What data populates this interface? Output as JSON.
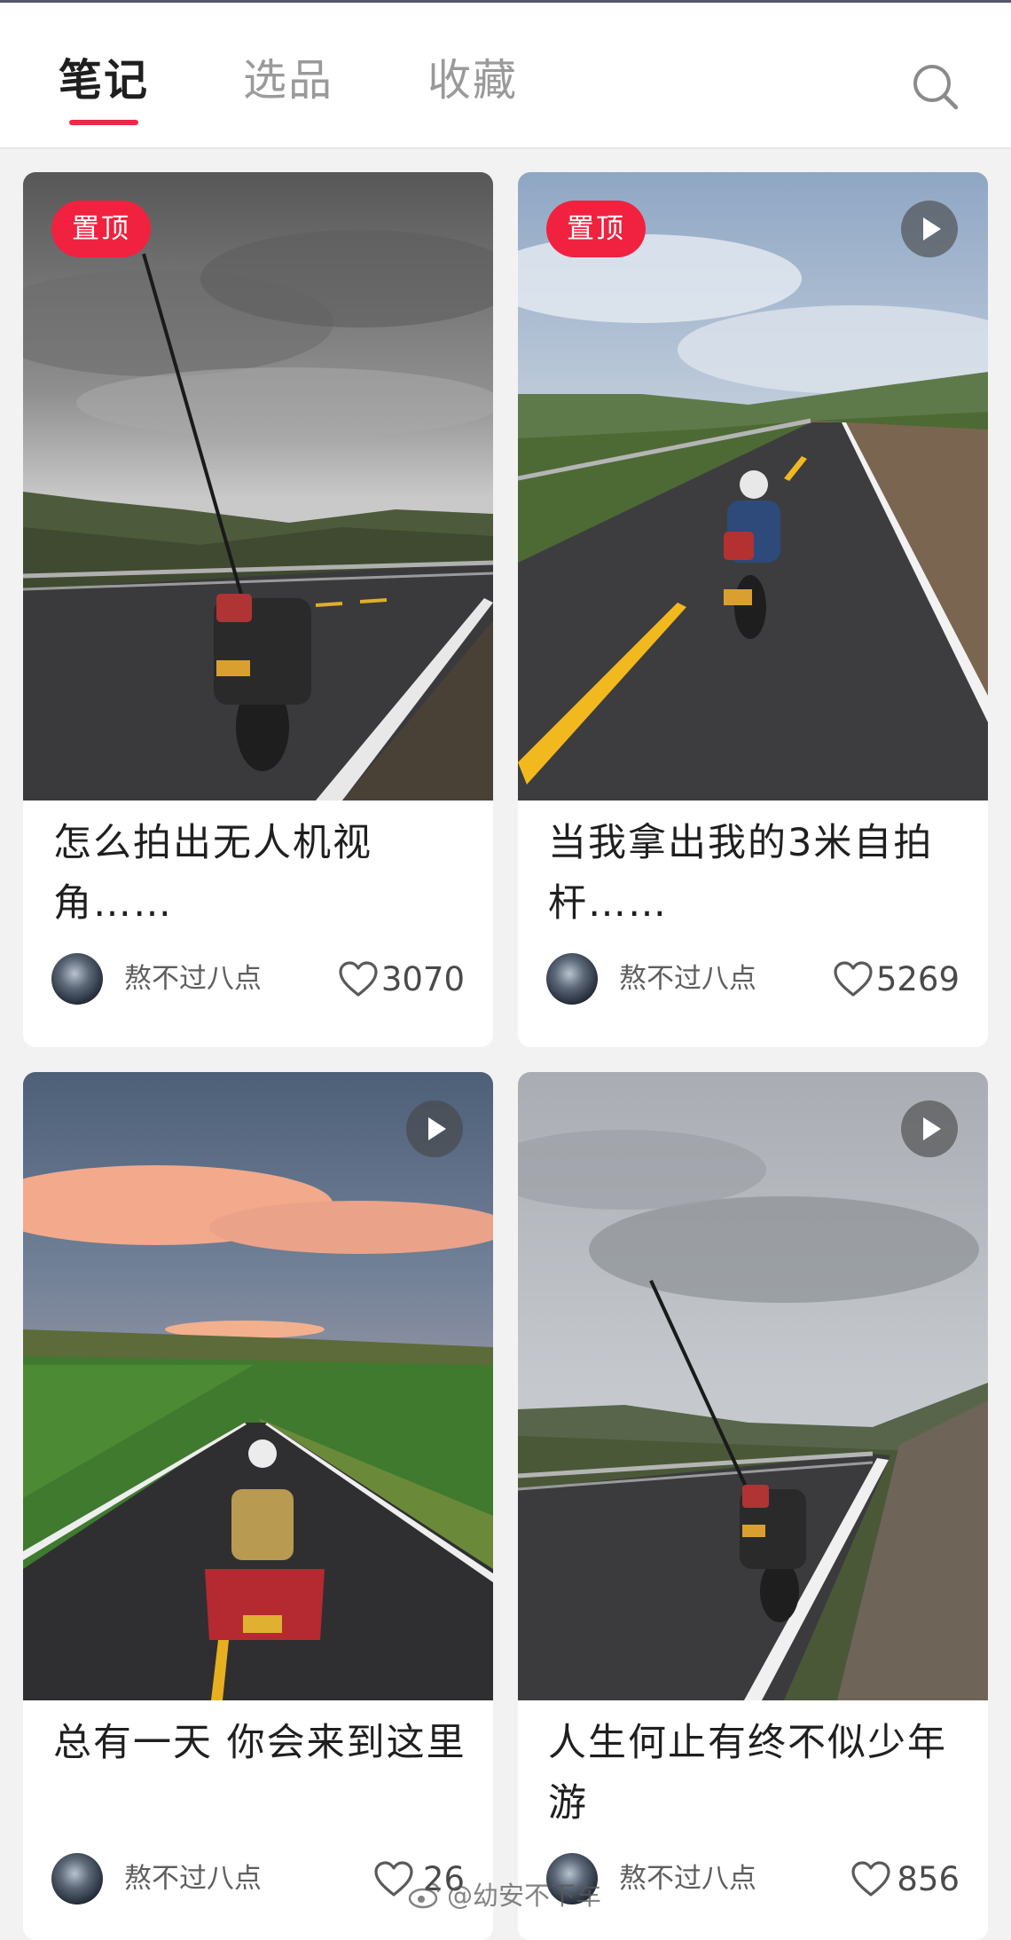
{
  "tabs": [
    {
      "label": "笔记",
      "active": true
    },
    {
      "label": "选品",
      "active": false
    },
    {
      "label": "收藏",
      "active": false
    }
  ],
  "accent_color": "#ea2a46",
  "cards": [
    {
      "pinned": true,
      "pin_label": "置顶",
      "has_video": false,
      "title": "怎么拍出无人机视角……",
      "author": "熬不过八点",
      "likes": "3070"
    },
    {
      "pinned": true,
      "pin_label": "置顶",
      "has_video": true,
      "title": "当我拿出我的3米自拍杆……",
      "author": "熬不过八点",
      "likes": "5269"
    },
    {
      "pinned": false,
      "has_video": true,
      "title": "总有一天 你会来到这里",
      "author": "熬不过八点",
      "likes": "26"
    },
    {
      "pinned": false,
      "has_video": true,
      "title": "人生何止有终不似少年游",
      "author": "熬不过八点",
      "likes": "856"
    }
  ],
  "watermark": "@幼安不下车",
  "icons": {
    "search": "search-icon",
    "play": "play-icon",
    "heart": "heart-icon"
  }
}
